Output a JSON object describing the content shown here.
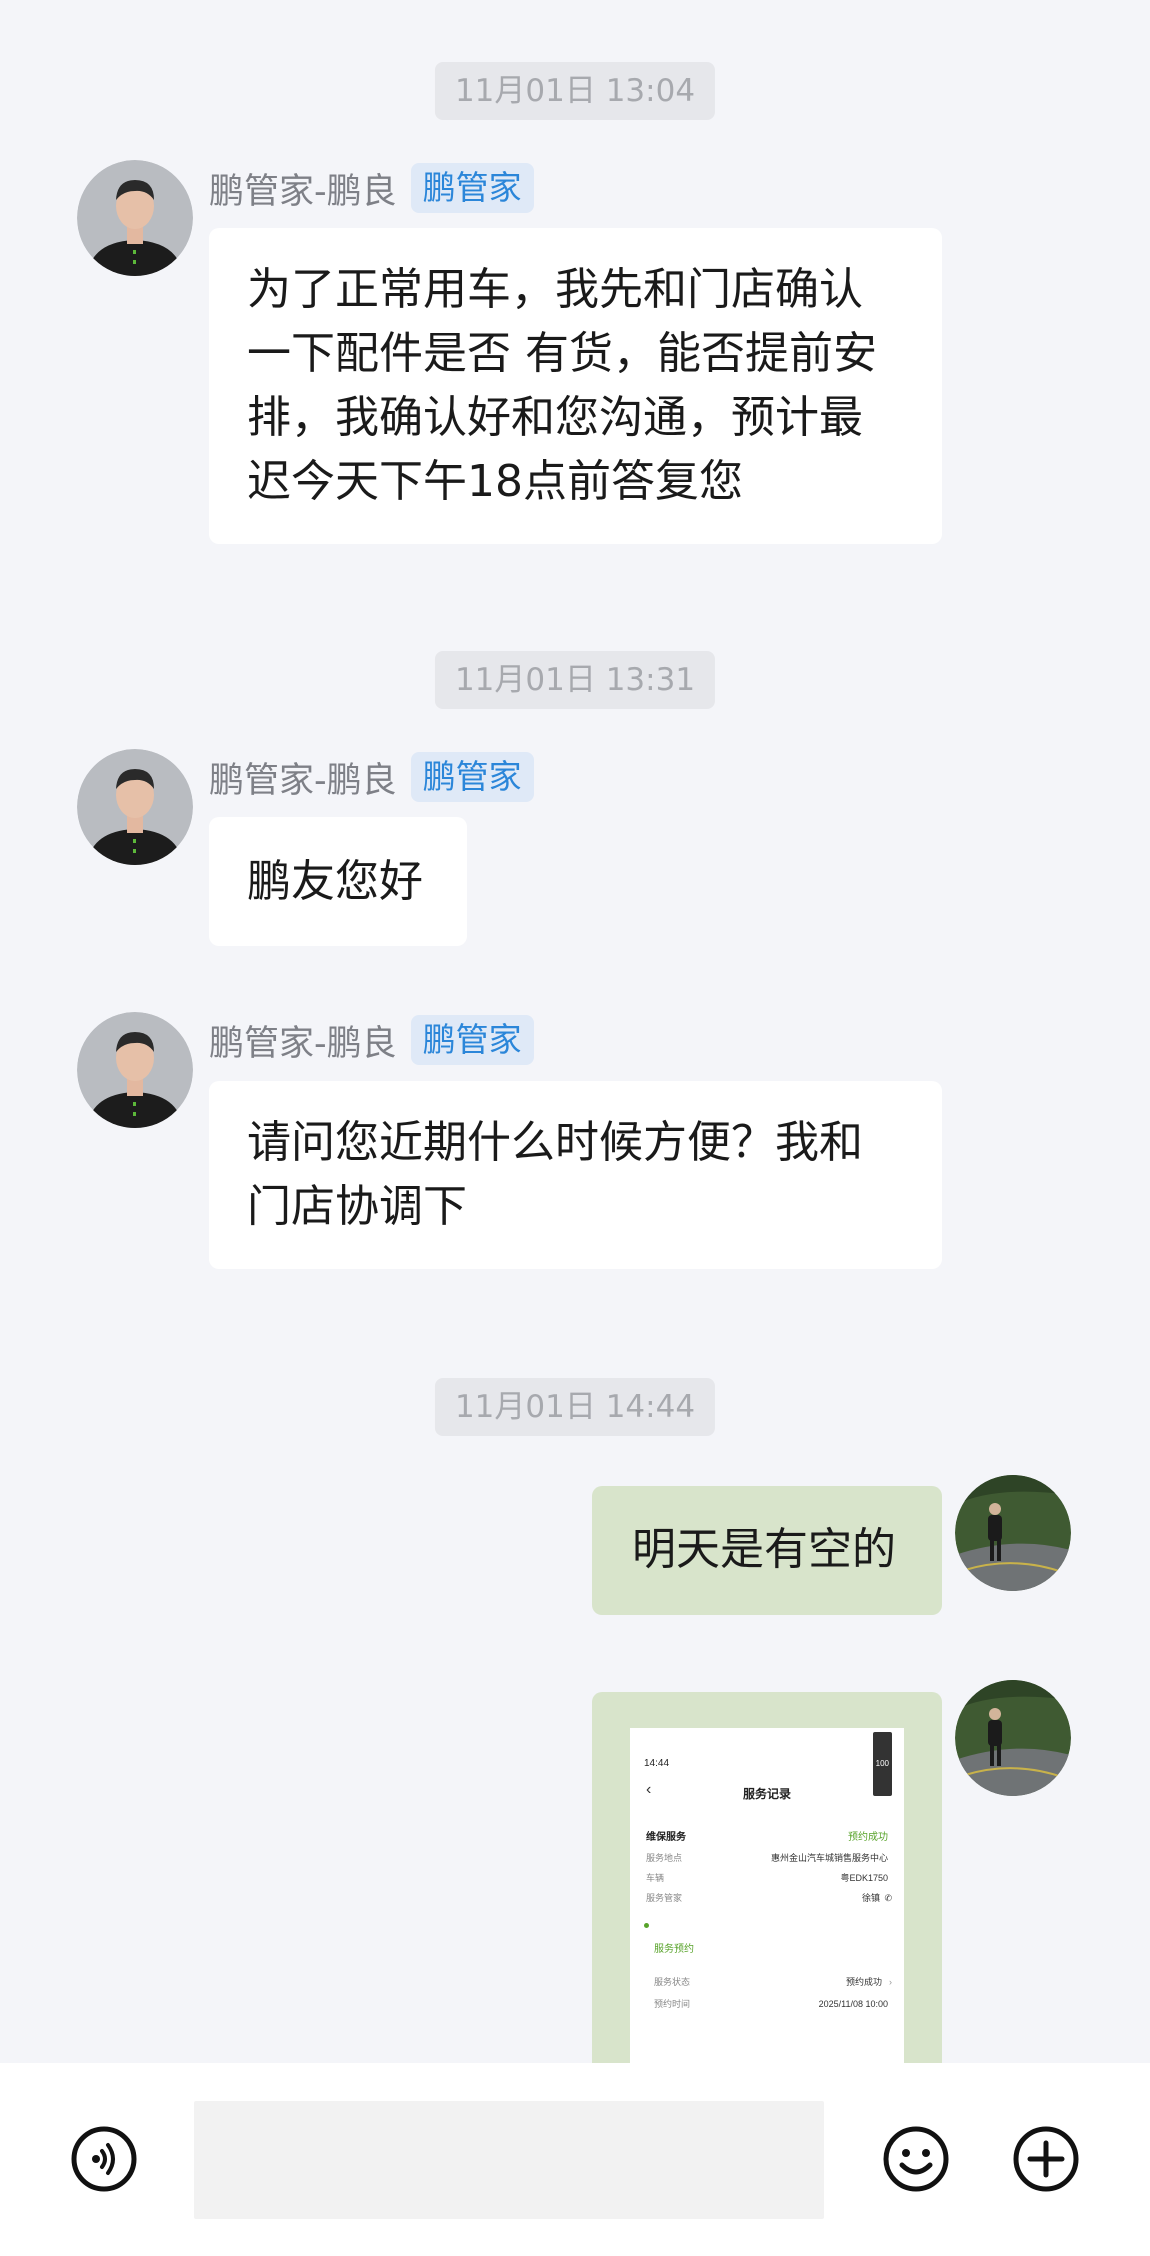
{
  "colors": {
    "background": "#f4f5f9",
    "incoming_bubble": "#ffffff",
    "outgoing_bubble": "#d8e4cb",
    "badge_bg": "#dfe9f7",
    "badge_text": "#2b86d9",
    "timestamp_bg": "#e6e7eb",
    "accent_green": "#58a32a"
  },
  "messages": {
    "ts1": "11月01日 13:04",
    "msg1": {
      "sender": "鹏管家-鹏良",
      "badge": "鹏管家",
      "lines": [
        "为了正常用车，我先和门店确认",
        "一下配件是否 有货，能否提前安",
        "排，我确认好和您沟通，预计最",
        "迟今天下午18点前答复您"
      ]
    },
    "ts2": "11月01日 13:31",
    "msg2": {
      "sender": "鹏管家-鹏良",
      "badge": "鹏管家",
      "text": "鹏友您好"
    },
    "msg3": {
      "sender": "鹏管家-鹏良",
      "badge": "鹏管家",
      "lines": [
        "请问您近期什么时候方便？我和",
        "门店协调下"
      ]
    },
    "ts3": "11月01日 14:44",
    "msg4": {
      "text": "明天是有空的"
    },
    "msg5": {
      "image": {
        "status_time": "14:44",
        "battery": "100",
        "title": "服务记录",
        "service_label": "维保服务",
        "service_status": "预约成功",
        "rows": [
          {
            "k": "服务地点",
            "v": "惠州金山汽车城销售服务中心"
          },
          {
            "k": "车辆",
            "v": "粤EDK1750"
          },
          {
            "k": "服务管家",
            "v": "徐镇"
          }
        ],
        "section_title": "服务预约",
        "rows2": [
          {
            "k": "服务状态",
            "v": "预约成功"
          },
          {
            "k": "预约时间",
            "v": "2025/11/08 10:00"
          }
        ]
      }
    }
  },
  "input_bar": {
    "voice_icon": "voice-icon",
    "emoji_icon": "emoji-icon",
    "add_icon": "plus-icon",
    "placeholder": ""
  }
}
